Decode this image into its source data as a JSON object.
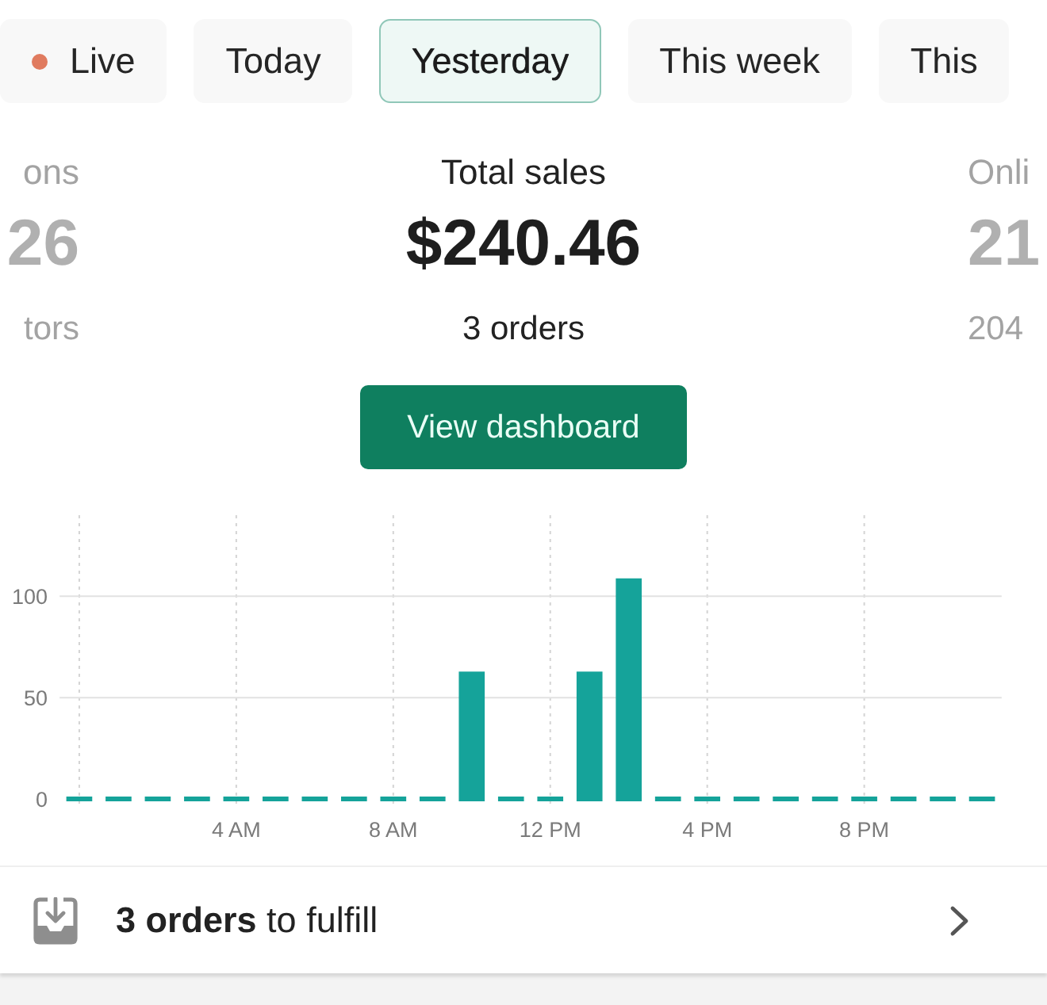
{
  "period_tabs": [
    {
      "label": "Live",
      "kind": "live",
      "selected": false
    },
    {
      "label": "Today",
      "kind": "period",
      "selected": false
    },
    {
      "label": "Yesterday",
      "kind": "period",
      "selected": true
    },
    {
      "label": "This week",
      "kind": "period",
      "selected": false
    },
    {
      "label": "This",
      "kind": "period",
      "selected": false
    }
  ],
  "metrics": [
    {
      "label": "ons",
      "value": "26",
      "detail": "tors",
      "selected": false
    },
    {
      "label": "Total sales",
      "value": "$240.46",
      "detail": "3 orders",
      "selected": true
    },
    {
      "label": "Onli",
      "value": "21",
      "detail": "204",
      "selected": false
    }
  ],
  "dashboard_button": {
    "label": "View dashboard"
  },
  "sales_chart": {
    "chart_data": {
      "type": "bar",
      "categories": [
        null,
        null,
        null,
        null,
        "4 AM",
        null,
        null,
        null,
        "8 AM",
        null,
        null,
        null,
        "12 PM",
        null,
        null,
        null,
        "4 PM",
        null,
        null,
        null,
        "8 PM",
        null,
        null,
        null
      ],
      "values": [
        0,
        0,
        0,
        0,
        0,
        0,
        0,
        0,
        0,
        0,
        64,
        0,
        0,
        64,
        110,
        0,
        0,
        0,
        0,
        0,
        0,
        0,
        0,
        0
      ],
      "ylim": [
        0,
        140
      ],
      "yticks": [
        0,
        50,
        100
      ],
      "grid": true
    }
  },
  "fulfill_row": {
    "text": "**3 orders** to fulfill"
  }
}
